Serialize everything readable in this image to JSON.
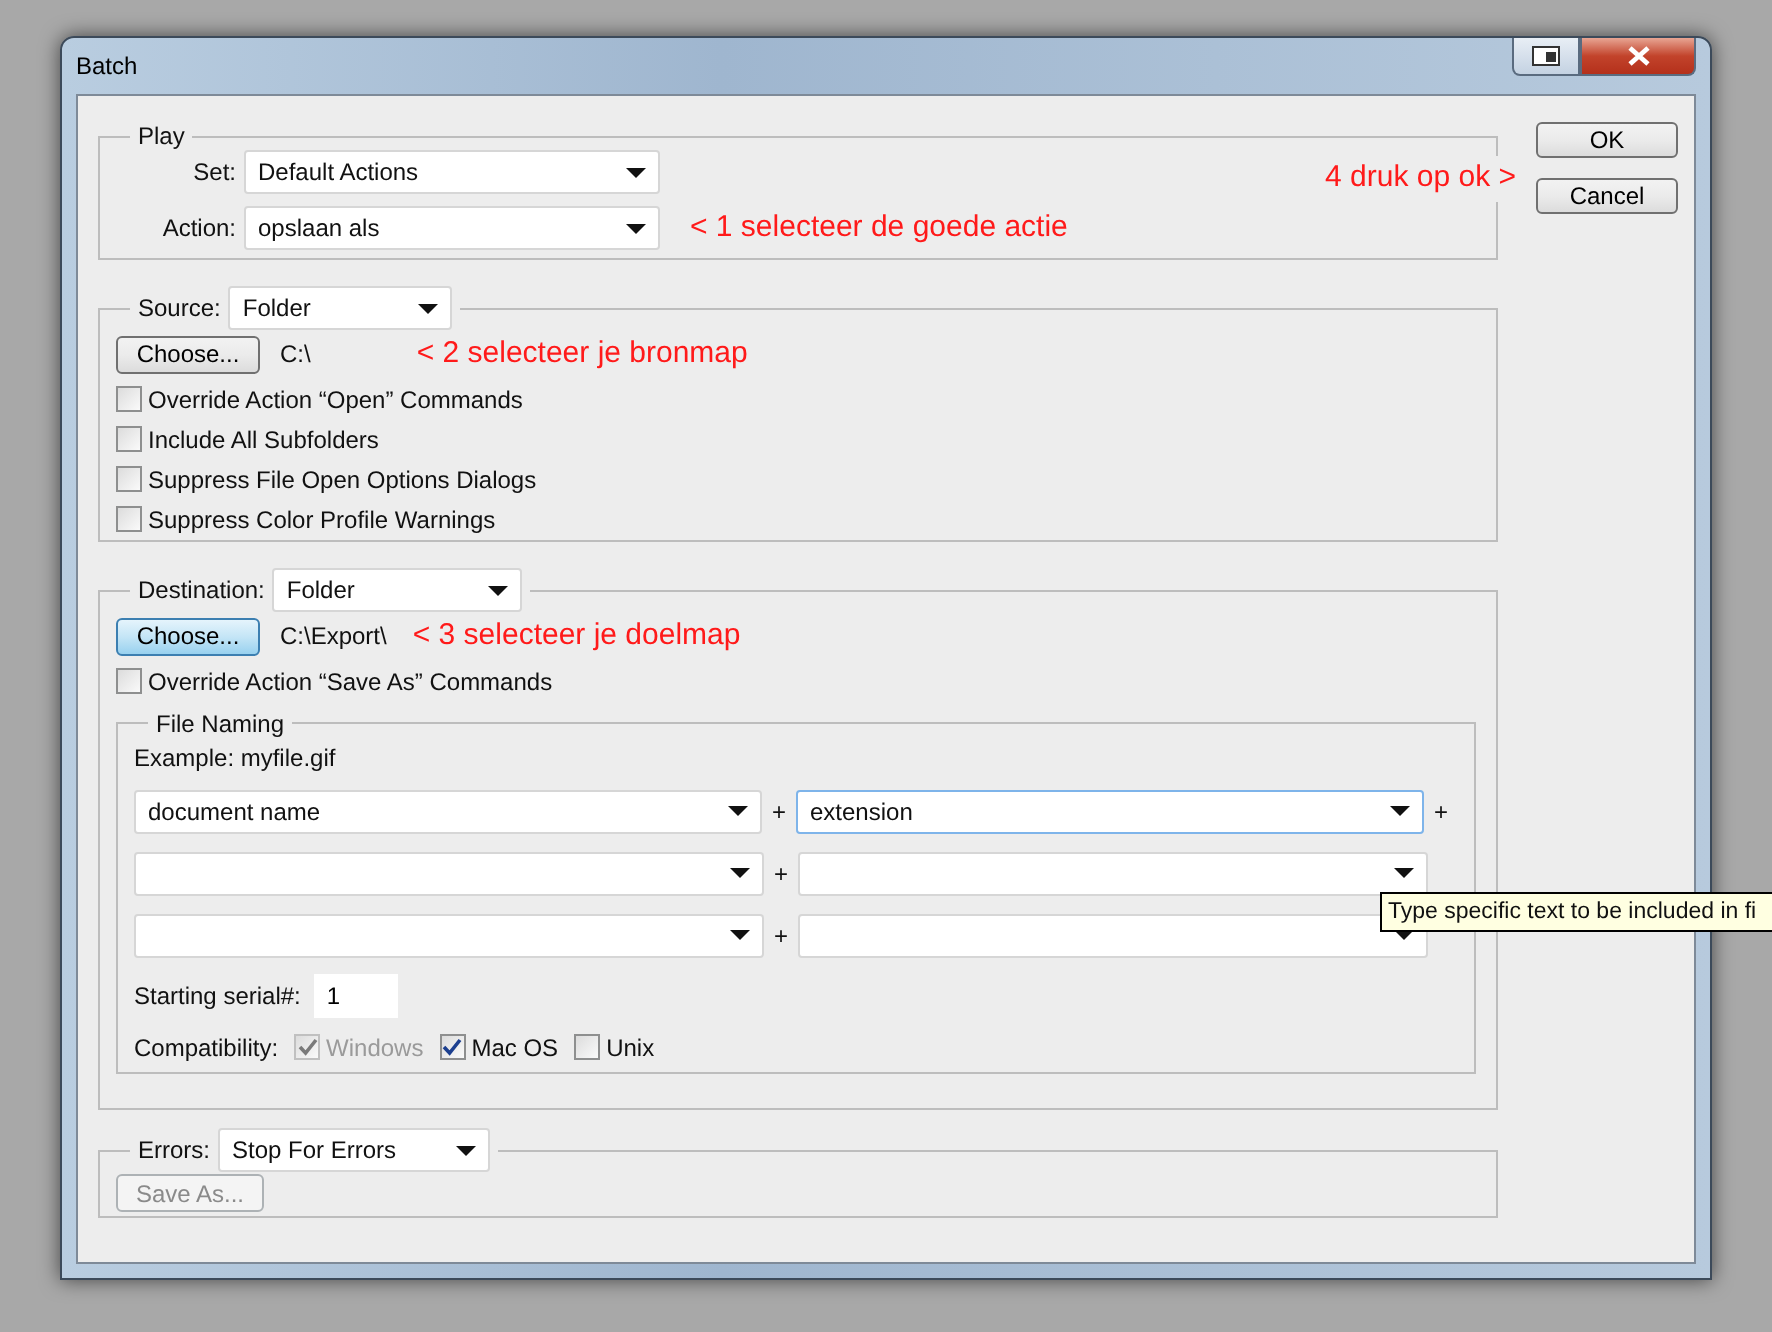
{
  "window": {
    "title": "Batch"
  },
  "play": {
    "legend": "Play",
    "set": {
      "label": "Set:",
      "value": "Default Actions"
    },
    "action": {
      "label": "Action:",
      "value": "opslaan als"
    },
    "action_note": "< 1 selecteer de goede actie",
    "ok_note": "4 druk op ok >"
  },
  "source": {
    "label": "Source:",
    "value": "Folder",
    "choose_button": {
      "label": "Choose...",
      "focused": false
    },
    "path": "C:\\",
    "note": "< 2 selecteer je bronmap",
    "options": [
      {
        "label": "Override Action “Open” Commands",
        "checked": false
      },
      {
        "label": "Include All Subfolders",
        "checked": false
      },
      {
        "label": "Suppress File Open Options Dialogs",
        "checked": false
      },
      {
        "label": "Suppress Color Profile Warnings",
        "checked": false
      }
    ]
  },
  "destination": {
    "label": "Destination:",
    "value": "Folder",
    "choose_button": {
      "label": "Choose...",
      "focused": true
    },
    "path": "C:\\Export\\",
    "note": "< 3 selecteer je doelmap",
    "options": [
      {
        "label": "Override Action “Save As” Commands",
        "checked": false
      }
    ],
    "file_naming": {
      "legend": "File Naming",
      "example": "Example: myfile.gif",
      "rows": [
        {
          "left": {
            "value": "document name",
            "focused": false
          },
          "right": {
            "value": "extension",
            "focused": true
          },
          "trailing_plus": true
        },
        {
          "left": {
            "focused": false
          },
          "right": {
            "focused": false
          },
          "trailing_plus": false
        },
        {
          "left": {
            "focused": false
          },
          "right": {
            "focused": false
          },
          "trailing_plus": false
        }
      ],
      "plus": "+",
      "serial": {
        "label": "Starting serial#:",
        "value": "1"
      },
      "compatibility": {
        "label": "Compatibility:",
        "options": [
          {
            "label": "Windows",
            "checked": true,
            "disabled": true
          },
          {
            "label": "Mac OS",
            "checked": true,
            "disabled": false
          },
          {
            "label": "Unix",
            "checked": false,
            "disabled": false
          }
        ]
      }
    }
  },
  "errors": {
    "label": "Errors:",
    "value": "Stop For Errors",
    "save_button": {
      "label": "Save As...",
      "disabled": true
    }
  },
  "buttons": [
    {
      "label": "OK"
    },
    {
      "label": "Cancel"
    }
  ],
  "tooltip": "Type specific text to be included in fi"
}
